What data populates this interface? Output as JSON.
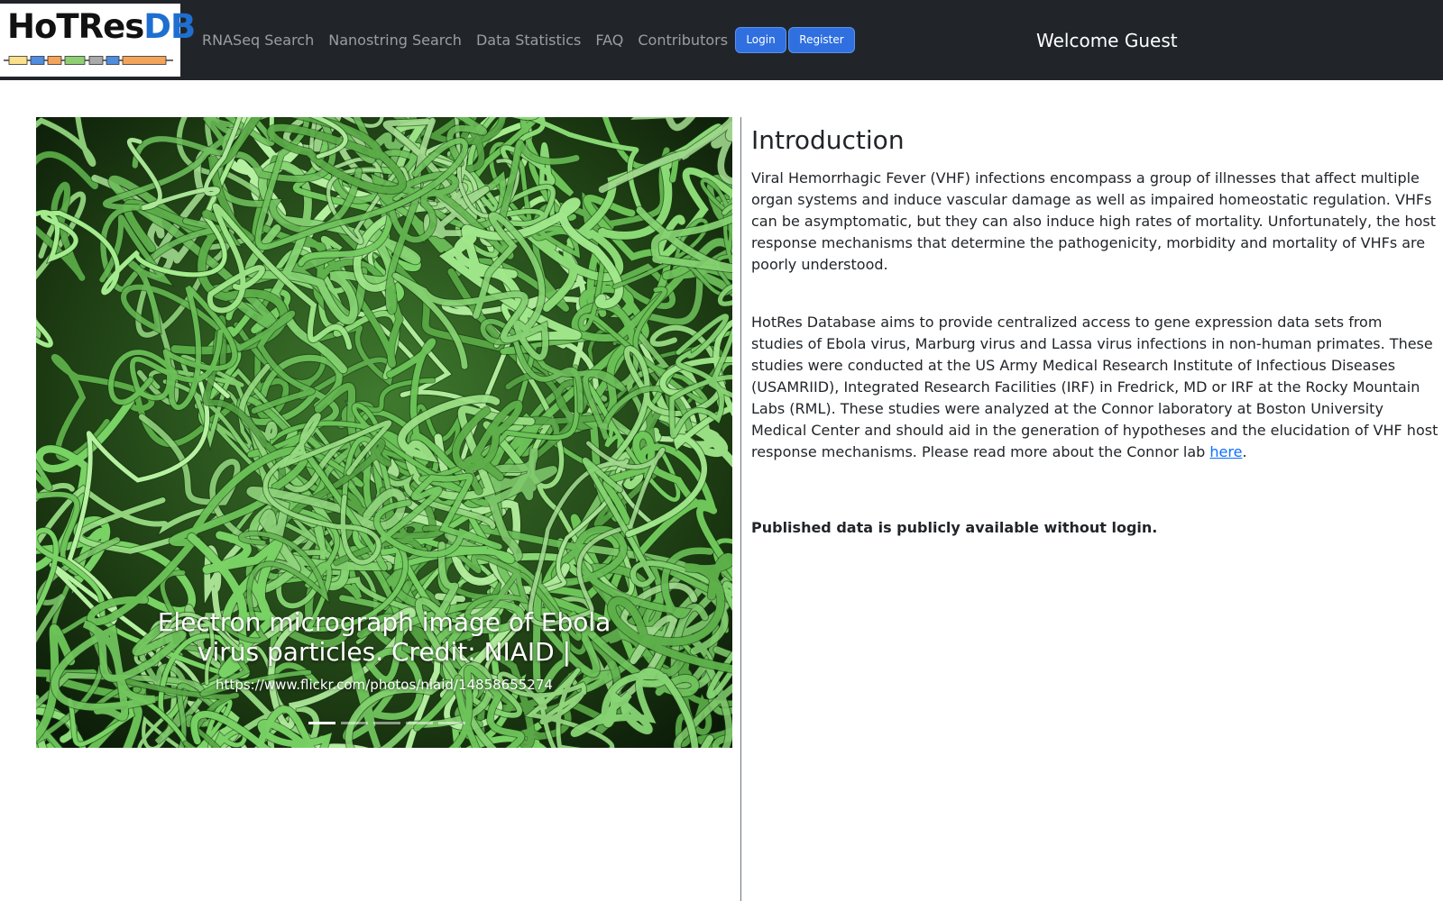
{
  "navbar": {
    "logo": {
      "text_part1": "HoTRes",
      "text_part2": "DB"
    },
    "links": [
      "RNASeq Search",
      "Nanostring Search",
      "Data Statistics",
      "FAQ",
      "Contributors"
    ],
    "login_label": "Login",
    "register_label": "Register",
    "welcome": "Welcome Guest"
  },
  "carousel": {
    "caption_title": "Electron micrograph image of Ebola virus particles. Credit: NIAID |",
    "caption_sub": "https://www.flickr.com/photos/niaid/14858655274",
    "slide_count": 5,
    "active_index": 0
  },
  "content": {
    "heading": "Introduction",
    "paragraph1": "Viral Hemorrhagic Fever (VHF) infections encompass a group of illnesses that affect multiple organ systems and induce vascular damage as well as impaired homeostatic regulation. VHFs can be asymptomatic, but they can also induce high rates of mortality. Unfortunately, the host response mechanisms that determine the pathogenicity, morbidity and mortality of VHFs are poorly understood.",
    "paragraph2": "HotRes Database aims to provide centralized access to gene expression data sets from studies of Ebola virus, Marburg virus and Lassa virus infections in non-human primates. These studies were conducted at the US Army Medical Research Institute of Infectious Diseases (USAMRIID), Integrated Research Facilities (IRF) in Fredrick, MD or IRF at the Rocky Mountain Labs (RML). These studies were analyzed at the Connor laboratory at Boston University Medical Center and should aid in the generation of hypotheses and the elucidation of VHF host response mechanisms. Please read more about the Connor lab",
    "link_text": "here",
    "link_suffix": ".",
    "notice": "Published data is publicly available without login."
  },
  "colors": {
    "navbar_bg": "#212529",
    "button_primary": "#2f6fe0",
    "link": "#0d6efd",
    "logo_blue": "#1f6fd1",
    "micrograph_green": "#8fe07a"
  }
}
